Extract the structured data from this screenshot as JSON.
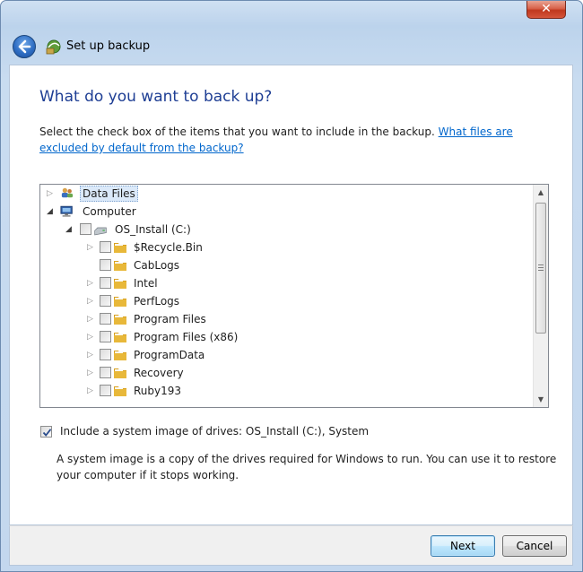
{
  "window": {
    "close_label": "✕"
  },
  "header": {
    "title": "Set up backup"
  },
  "main": {
    "heading": "What do you want to back up?",
    "instruction": "Select the check box of the items that you want to include in the backup.",
    "help_link": "What files are excluded by default from the backup?"
  },
  "tree": {
    "data_files": "Data Files",
    "computer": "Computer",
    "drive": "OS_Install (C:)",
    "folders": [
      {
        "name": "$Recycle.Bin",
        "expandable": true
      },
      {
        "name": "CabLogs",
        "expandable": false
      },
      {
        "name": "Intel",
        "expandable": true
      },
      {
        "name": "PerfLogs",
        "expandable": true
      },
      {
        "name": "Program Files",
        "expandable": true
      },
      {
        "name": "Program Files (x86)",
        "expandable": true
      },
      {
        "name": "ProgramData",
        "expandable": true
      },
      {
        "name": "Recovery",
        "expandable": true
      },
      {
        "name": "Ruby193",
        "expandable": true
      }
    ]
  },
  "system_image": {
    "checked": true,
    "label": "Include a system image of drives: OS_Install (C:), System",
    "description": "A system image is a copy of the drives required for Windows to run. You can use it to restore your computer if it stops working."
  },
  "footer": {
    "next_label": "Next",
    "cancel_label": "Cancel"
  },
  "colors": {
    "heading": "#1e3e94",
    "link": "#0066cc",
    "close": "#c7442b",
    "folder": "#e8b83a"
  }
}
